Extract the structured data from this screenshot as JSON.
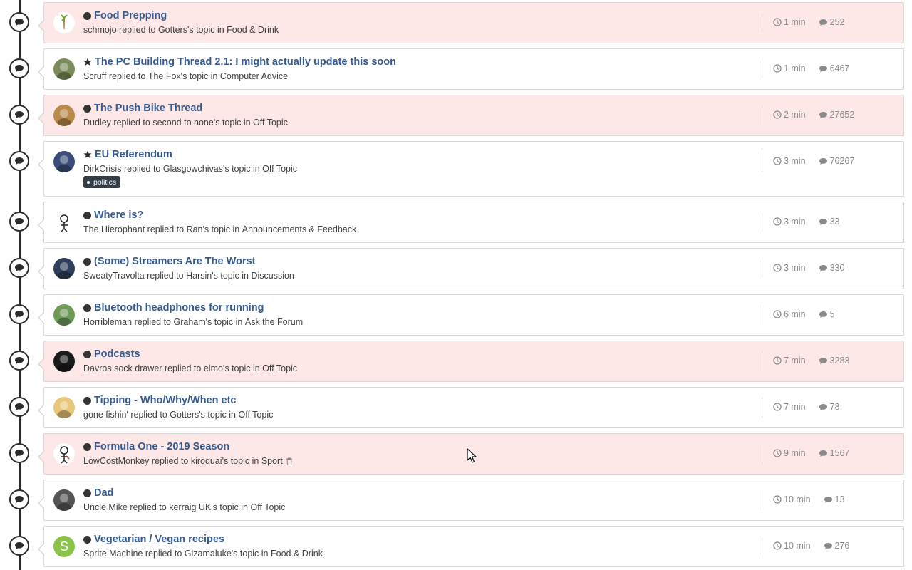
{
  "activity_stream": {
    "items": [
      {
        "title": "Food Prepping",
        "user": "schmojo",
        "action": "replied to",
        "owner": "Gotters's",
        "topic_word": "topic in",
        "forum": "Food & Drink",
        "time": "1 min",
        "replies": "252",
        "unread": true,
        "icon": "bullet-icon",
        "avatar_icon": "carrot-avatar",
        "avatar_color": "#ffffff"
      },
      {
        "title": "The PC Building Thread 2.1: I might actually update this soon",
        "user": "Scruff",
        "action": "replied to",
        "owner": "The Fox's",
        "topic_word": "topic in",
        "forum": "Computer Advice",
        "time": "1 min",
        "replies": "6467",
        "unread": false,
        "icon": "star-icon",
        "avatar_icon": "pixel-character-avatar",
        "avatar_color": "#7a8c5a"
      },
      {
        "title": "The Push Bike Thread",
        "user": "Dudley",
        "action": "replied to",
        "owner": "second to none's",
        "topic_word": "topic in",
        "forum": "Off Topic",
        "time": "2 min",
        "replies": "27652",
        "unread": true,
        "icon": "bullet-icon",
        "avatar_icon": "dog-photo-avatar",
        "avatar_color": "#b98a4a"
      },
      {
        "title": "EU Referendum",
        "user": "DirkCrisis",
        "action": "replied to",
        "owner": "Glasgowchivas's",
        "topic_word": "topic in",
        "forum": "Off Topic",
        "time": "3 min",
        "replies": "76267",
        "unread": false,
        "icon": "star-icon",
        "tag": "politics",
        "avatar_icon": "portrait-avatar",
        "avatar_color": "#3b4d7a"
      },
      {
        "title": "Where is?",
        "user": "The Hierophant",
        "action": "replied to",
        "owner": "Ran's",
        "topic_word": "topic in",
        "forum": "Announcements & Feedback",
        "time": "3 min",
        "replies": "33",
        "unread": false,
        "icon": "bullet-icon",
        "avatar_icon": "sketch-avatar",
        "avatar_color": "#ffffff"
      },
      {
        "title": "(Some) Streamers Are The Worst",
        "user": "SweatyTravolta",
        "action": "replied to",
        "owner": "Harsin's",
        "topic_word": "topic in",
        "forum": "Discussion",
        "time": "3 min",
        "replies": "330",
        "unread": false,
        "icon": "bullet-icon",
        "avatar_icon": "hooded-figure-avatar",
        "avatar_color": "#2f3e5a"
      },
      {
        "title": "Bluetooth headphones for running",
        "user": "Horribleman",
        "action": "replied to",
        "owner": "Graham's",
        "topic_word": "topic in",
        "forum": "Ask the Forum",
        "time": "6 min",
        "replies": "5",
        "unread": false,
        "icon": "bullet-icon",
        "avatar_icon": "cartoon-avatar",
        "avatar_color": "#6e9a5a"
      },
      {
        "title": "Podcasts",
        "user": "Davros sock drawer",
        "action": "replied to",
        "owner": "elmo's",
        "topic_word": "topic in",
        "forum": "Off Topic",
        "time": "7 min",
        "replies": "3283",
        "unread": true,
        "icon": "bullet-icon",
        "avatar_icon": "dark-face-avatar",
        "avatar_color": "#1a1a1a"
      },
      {
        "title": "Tipping - Who/Why/When etc",
        "user": "gone fishin'",
        "action": "replied to",
        "owner": "Gotters's",
        "topic_word": "topic in",
        "forum": "Off Topic",
        "time": "7 min",
        "replies": "78",
        "unread": false,
        "icon": "bullet-icon",
        "avatar_icon": "sunset-fisherman-avatar",
        "avatar_color": "#e8c77a"
      },
      {
        "title": "Formula One - 2019 Season",
        "user": "LowCostMonkey",
        "action": "replied to",
        "owner": "kiroquai's",
        "topic_word": "topic in",
        "forum": "Sport",
        "time": "9 min",
        "replies": "1567",
        "unread": true,
        "icon": "bullet-icon",
        "trash": true,
        "avatar_icon": "figure-sketch-avatar",
        "avatar_color": "#ffffff"
      },
      {
        "title": "Dad",
        "user": "Uncle Mike",
        "action": "replied to",
        "owner": "kerraig UK's",
        "topic_word": "topic in",
        "forum": "Off Topic",
        "time": "10 min",
        "replies": "13",
        "unread": false,
        "icon": "bullet-icon",
        "avatar_icon": "bw-portrait-avatar",
        "avatar_color": "#555555"
      },
      {
        "title": "Vegetarian / Vegan recipes",
        "user": "Sprite Machine",
        "action": "replied to",
        "owner": "Gizamaluke's",
        "topic_word": "topic in",
        "forum": "Food & Drink",
        "time": "10 min",
        "replies": "276",
        "unread": false,
        "icon": "bullet-icon",
        "letter": "S",
        "avatar_icon": "letter-avatar",
        "avatar_color": "#8bc34a"
      }
    ]
  },
  "colors": {
    "unread_bg": "#fde7e7",
    "title_link": "#355a8f",
    "timeline": "#2b2b2b"
  }
}
